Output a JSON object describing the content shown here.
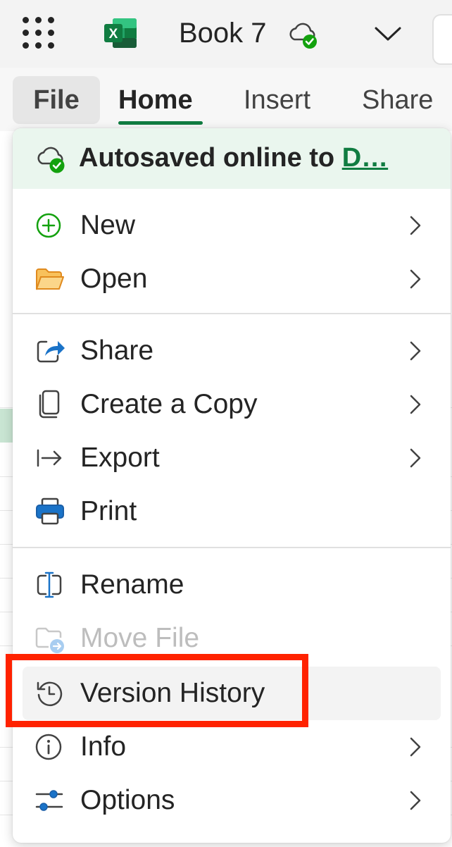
{
  "titlebar": {
    "doc_title": "Book 7",
    "icons": [
      "app-launcher-icon",
      "excel-logo-icon",
      "cloud-saved-icon",
      "chevron-down-icon"
    ]
  },
  "tabs": {
    "file": "File",
    "home": "Home",
    "insert": "Insert",
    "share": "Share"
  },
  "file_menu": {
    "autosave_prefix": "Autosaved online to ",
    "autosave_link": "D…",
    "items": {
      "new": "New",
      "open": "Open",
      "share": "Share",
      "create_copy": "Create a Copy",
      "export": "Export",
      "print": "Print",
      "rename": "Rename",
      "move_file": "Move File",
      "version_history": "Version History",
      "info": "Info",
      "options": "Options"
    }
  },
  "colors": {
    "accent_green": "#107c41",
    "autosave_bg": "#eaf6ee",
    "highlight_red": "#ff2200",
    "folder_orange": "#f0a030",
    "icon_blue": "#1a73c8"
  }
}
